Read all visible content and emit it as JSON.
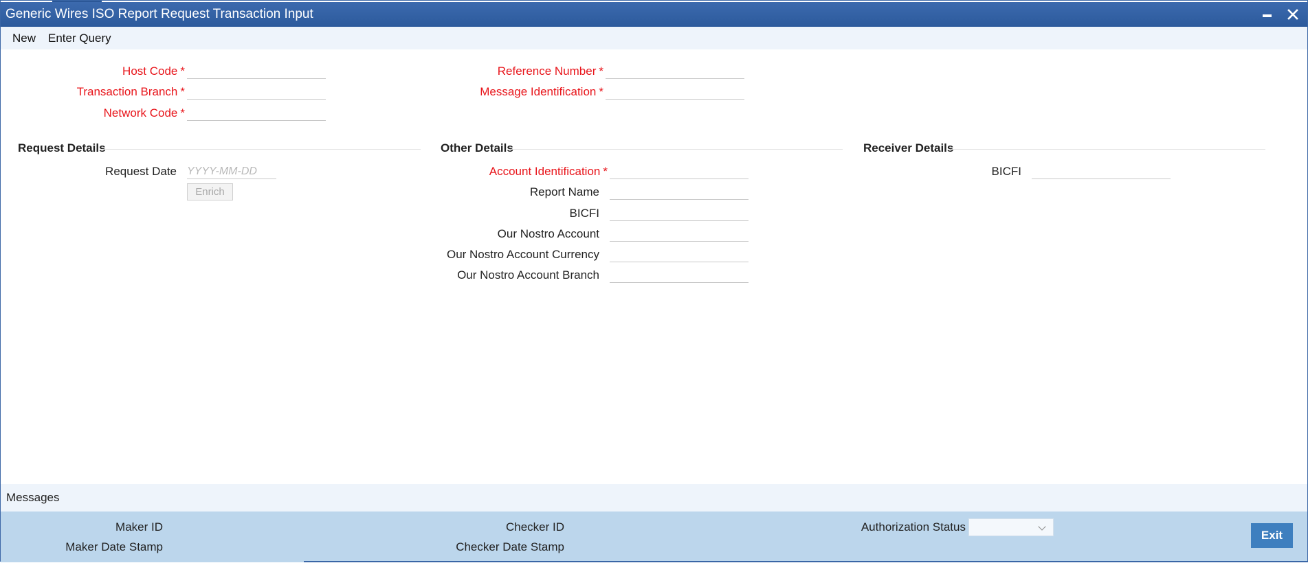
{
  "window": {
    "title": "Generic Wires ISO Report Request Transaction Input"
  },
  "menu": {
    "items": [
      "New",
      "Enter Query"
    ]
  },
  "header_fields": {
    "host_code": {
      "label": "Host Code",
      "value": ""
    },
    "transaction_branch": {
      "label": "Transaction Branch",
      "value": ""
    },
    "network_code": {
      "label": "Network Code",
      "value": ""
    },
    "reference_number": {
      "label": "Reference Number",
      "value": ""
    },
    "message_identification": {
      "label": "Message Identification",
      "value": ""
    },
    "required_marker": "*"
  },
  "request_details": {
    "title": "Request Details",
    "request_date_label": "Request Date",
    "request_date_placeholder": "YYYY-MM-DD",
    "enrich_label": "Enrich"
  },
  "other_details": {
    "title": "Other Details",
    "account_identification": "Account Identification",
    "report_name": "Report Name",
    "bicfi": "BICFI",
    "our_nostro_account": "Our Nostro Account",
    "our_nostro_account_currency": "Our Nostro Account Currency",
    "our_nostro_account_branch": "Our Nostro Account Branch"
  },
  "receiver_details": {
    "title": "Receiver Details",
    "bicfi": "BICFI"
  },
  "messages": {
    "label": "Messages"
  },
  "footer": {
    "maker_id": "Maker ID",
    "maker_date_stamp": "Maker Date Stamp",
    "checker_id": "Checker ID",
    "checker_date_stamp": "Checker Date Stamp",
    "authorization_status": "Authorization Status",
    "authorization_status_value": "",
    "exit_label": "Exit"
  },
  "colors": {
    "title_bar": "#2c5a9c",
    "required_label": "#e8141a",
    "footer_bg": "#bcd6ec",
    "exit_button": "#3e7fbf"
  },
  "icons": {
    "minimize": "minimize-icon",
    "close": "close-icon",
    "dropdown": "chevron-down-icon"
  }
}
